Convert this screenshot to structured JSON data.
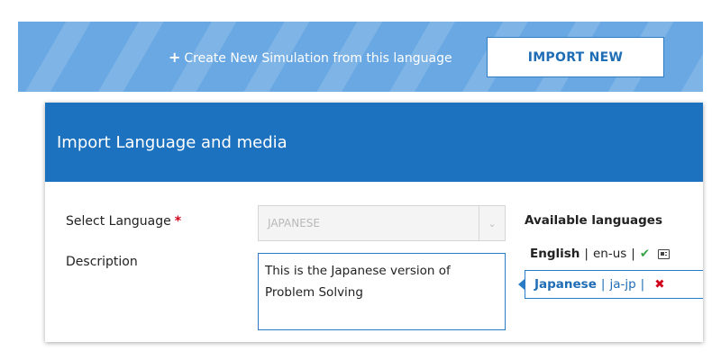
{
  "banner": {
    "create_label": "Create New Simulation from this language",
    "import_label": "IMPORT NEW"
  },
  "dialog": {
    "title": "Import Language and media",
    "select_language_label": "Select Language",
    "required_mark": "*",
    "select_language_value": "JAPANESE",
    "description_label": "Description",
    "description_value": "This is the Japanese version of Problem Solving",
    "available_title": "Available languages",
    "languages": [
      {
        "name": "English",
        "code": "en-us",
        "status": "default"
      },
      {
        "name": "Japanese",
        "code": "ja-jp",
        "status": "selected"
      }
    ],
    "separator": "|"
  },
  "icons": {
    "plus": "plus-icon",
    "dropdown": "chevron-down-icon",
    "check": "check-icon",
    "media": "media-icon",
    "remove": "close-icon"
  },
  "colors": {
    "banner": "#69a8e2",
    "header": "#1d72bf",
    "accent": "#2a7bc5",
    "check": "#3aa34a",
    "remove": "#d0021b"
  }
}
